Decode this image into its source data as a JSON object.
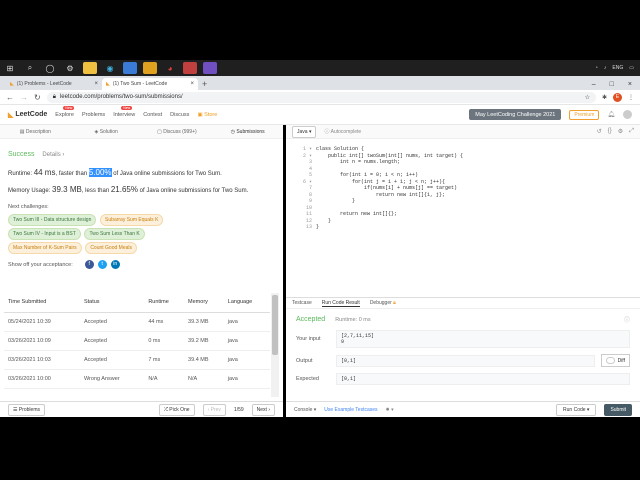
{
  "taskbar": {
    "lang": "ENG"
  },
  "browser": {
    "tabs": [
      {
        "label": "(1) Problems - LeetCode"
      },
      {
        "label": "(1) Two Sum - LeetCode"
      }
    ],
    "url": "leetcode.com/problems/two-sum/submissions/",
    "avatar_letter": "E"
  },
  "lc_nav": {
    "logo": "LeetCode",
    "links": [
      {
        "label": "Explore",
        "badge": "New"
      },
      {
        "label": "Problems",
        "badge": ""
      },
      {
        "label": "Interview",
        "badge": "New"
      },
      {
        "label": "Contest",
        "badge": ""
      },
      {
        "label": "Discuss",
        "badge": ""
      },
      {
        "label": "Store",
        "badge": ""
      }
    ],
    "challenge": "May LeetCoding Challenge 2021",
    "premium": "Premium"
  },
  "left_tabs": [
    "Description",
    "Solution",
    "Discuss (999+)",
    "Submissions"
  ],
  "result": {
    "status": "Success",
    "details": "Details",
    "runtime_label": "Runtime:",
    "runtime_value": "44 ms",
    "runtime_mid": ", faster than",
    "runtime_pct": "5.00%",
    "runtime_tail": "of Java online submissions for Two Sum.",
    "memory_label": "Memory Usage:",
    "memory_value": "39.3 MB",
    "memory_mid": ", less than",
    "memory_pct": "21.65%",
    "memory_tail": "of Java online submissions for Two Sum.",
    "next_label": "Next challenges:",
    "challenges_green": [
      "Two Sum III - Data structure design",
      "Two Sum IV - Input is a BST",
      "Two Sum Less Than K"
    ],
    "challenges_orange": [
      "Subarray Sum Equals K",
      "Max Number of K-Sum Pairs",
      "Count Good Meals"
    ],
    "share_label": "Show off your acceptance:"
  },
  "table": {
    "headers": [
      "Time Submitted",
      "Status",
      "Runtime",
      "Memory",
      "Language"
    ],
    "rows": [
      {
        "time": "05/24/2021 10:39",
        "status": "Accepted",
        "runtime": "44 ms",
        "memory": "39.3 MB",
        "lang": "java"
      },
      {
        "time": "03/26/2021 10:09",
        "status": "Accepted",
        "runtime": "0 ms",
        "memory": "39.2 MB",
        "lang": "java"
      },
      {
        "time": "03/26/2021 10:03",
        "status": "Accepted",
        "runtime": "7 ms",
        "memory": "39.4 MB",
        "lang": "java"
      },
      {
        "time": "03/26/2021 10:00",
        "status": "Wrong Answer",
        "runtime": "N/A",
        "memory": "N/A",
        "lang": "java"
      }
    ]
  },
  "left_bottom": {
    "problems": "Problems",
    "pick": "Pick One",
    "prev": "Prev",
    "page": "1/59",
    "next": "Next"
  },
  "editor": {
    "language": "Java",
    "autocomplete": "Autocomplete",
    "lines": [
      "class Solution {",
      "    public int[] twoSum(int[] nums, int target) {",
      "        int n = nums.length;",
      "",
      "        for(int i = 0; i < n; i++)",
      "            for(int j = i + 1; j < n; j++){",
      "                if(nums[i] + nums[j] == target)",
      "                    return new int[]{i, j};",
      "            }",
      "",
      "        return new int[]{};",
      "    }",
      "}"
    ]
  },
  "console_tabs": [
    "Testcase",
    "Run Code Result",
    "Debugger"
  ],
  "run_result": {
    "status": "Accepted",
    "runtime": "Runtime: 0 ms",
    "input_label": "Your input",
    "input_value": "[2,7,11,15]",
    "input_value2": "9",
    "output_label": "Output",
    "output_value": "[0,1]",
    "expected_label": "Expected",
    "expected_value": "[0,1]",
    "diff": "Diff"
  },
  "right_bottom": {
    "console": "Console",
    "use_example": "Use Example Testcases",
    "run": "Run Code",
    "submit": "Submit"
  }
}
